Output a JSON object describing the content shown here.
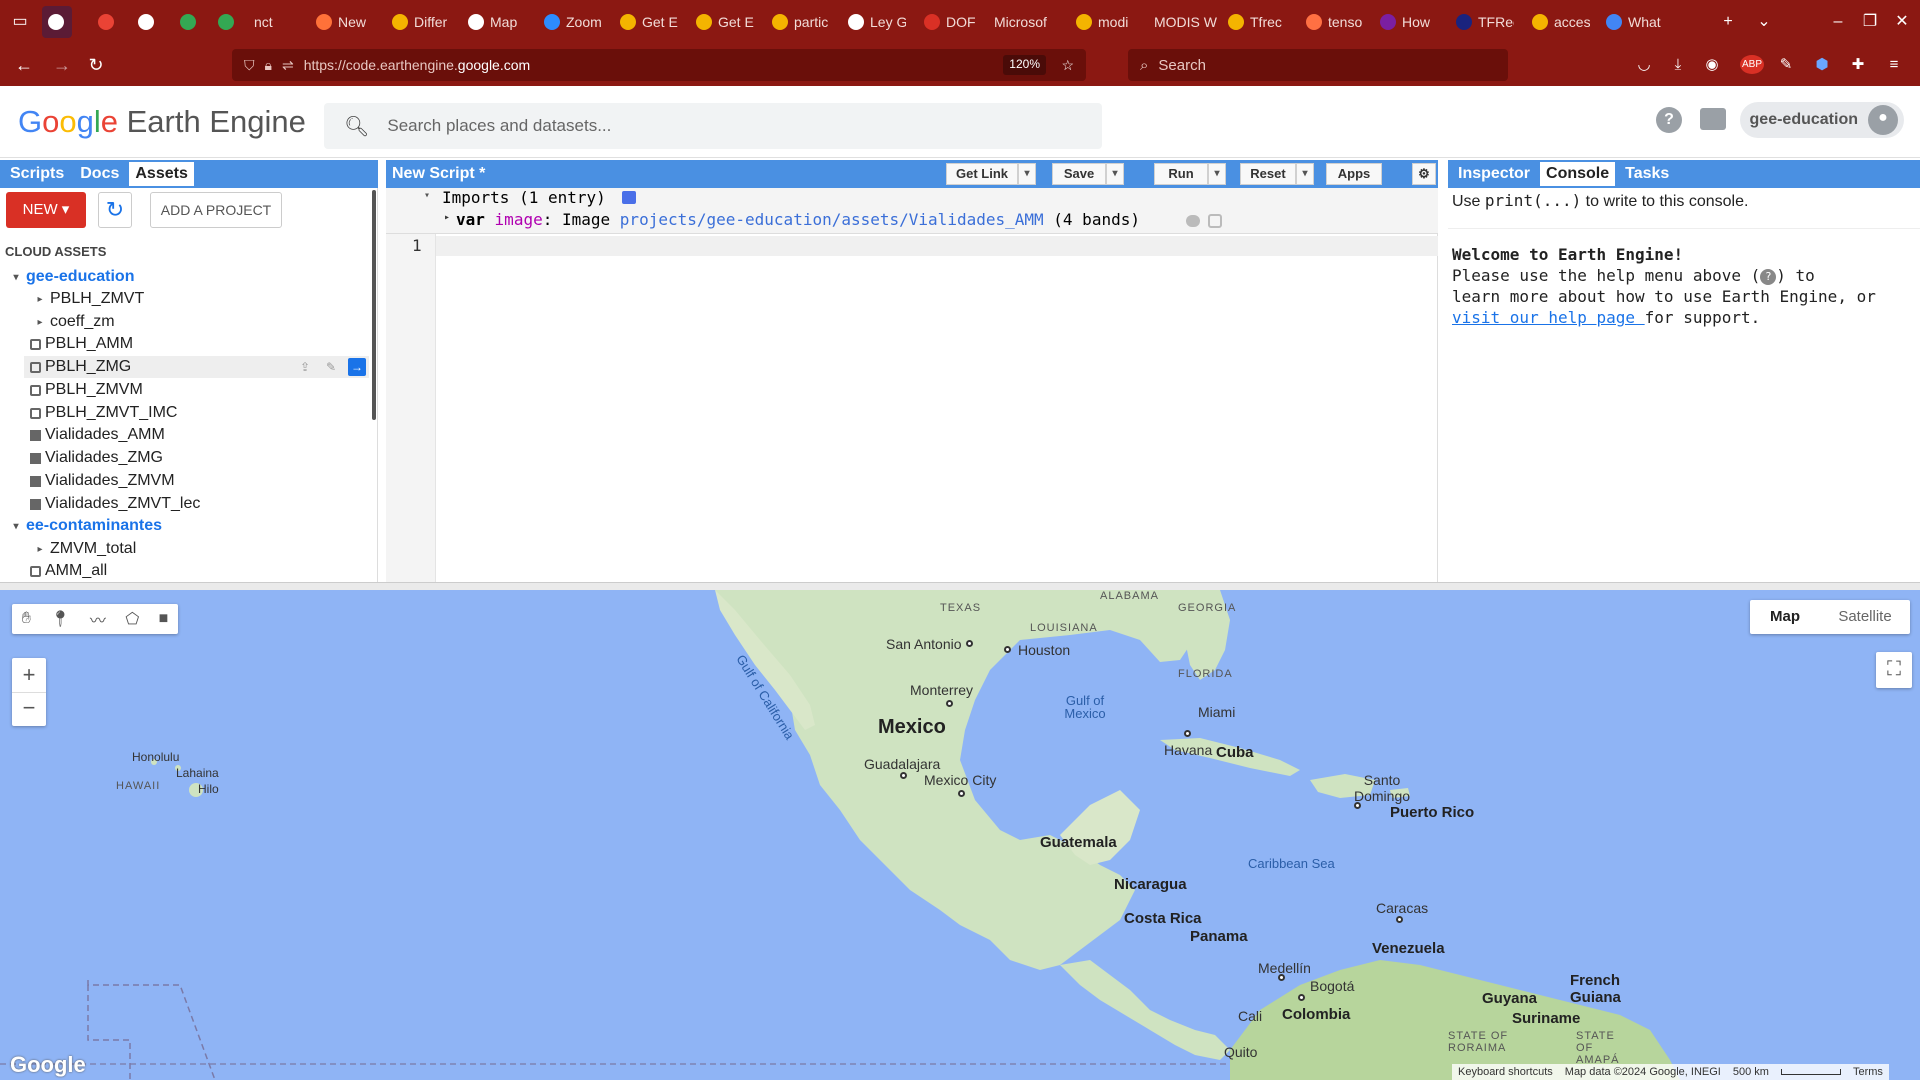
{
  "browser": {
    "tabs": [
      {
        "label": "",
        "color": "#ffffff"
      },
      {
        "label": "",
        "color": "#ea4335"
      },
      {
        "label": "",
        "color": "#ffffff"
      },
      {
        "label": "",
        "color": "#34a853"
      },
      {
        "label": "",
        "color": "#34a853"
      },
      {
        "label": "nct",
        "color": ""
      },
      {
        "label": "New",
        "color": "#ff7139"
      },
      {
        "label": "Differ",
        "color": "#f4b400"
      },
      {
        "label": "Map",
        "color": "#ffffff"
      },
      {
        "label": "Zoom",
        "color": "#2d8cff"
      },
      {
        "label": "Get E",
        "color": "#f4b400"
      },
      {
        "label": "Get E",
        "color": "#f4b400"
      },
      {
        "label": "partic",
        "color": "#f4b400"
      },
      {
        "label": "Ley G",
        "color": "#ffffff"
      },
      {
        "label": "DOF",
        "color": "#d93025"
      },
      {
        "label": "Microsof",
        "color": ""
      },
      {
        "label": "modi",
        "color": "#f4b400"
      },
      {
        "label": "MODIS W",
        "color": ""
      },
      {
        "label": "Tfrec",
        "color": "#f4b400"
      },
      {
        "label": "tenso",
        "color": "#ff7043"
      },
      {
        "label": "How",
        "color": "#7b1fa2"
      },
      {
        "label": "TFRec",
        "color": "#1a237e"
      },
      {
        "label": "acces",
        "color": "#f4b400"
      },
      {
        "label": "What",
        "color": "#4285f4"
      }
    ],
    "url_prefix": "https://code.earthengine.",
    "url_host": "google.com",
    "zoom": "120%",
    "search_placeholder": "Search"
  },
  "header": {
    "logo_google": [
      "G",
      "o",
      "o",
      "g",
      "l",
      "e"
    ],
    "logo_rest": " Earth Engine",
    "search_placeholder": "Search places and datasets...",
    "username": "gee-education"
  },
  "left_panel": {
    "tabs": [
      "Scripts",
      "Docs",
      "Assets"
    ],
    "new_label": "NEW",
    "add_project_label": "ADD A PROJECT",
    "cloud_assets_label": "CLOUD ASSETS",
    "tree": [
      {
        "label": "gee-education",
        "type": "root"
      },
      {
        "label": "PBLH_ZMVT",
        "type": "folder"
      },
      {
        "label": "coeff_zm",
        "type": "folder"
      },
      {
        "label": "PBLH_AMM",
        "type": "collection"
      },
      {
        "label": "PBLH_ZMG",
        "type": "collection"
      },
      {
        "label": "PBLH_ZMVM",
        "type": "collection"
      },
      {
        "label": "PBLH_ZMVT_IMC",
        "type": "collection"
      },
      {
        "label": "Vialidades_AMM",
        "type": "image"
      },
      {
        "label": "Vialidades_ZMG",
        "type": "image"
      },
      {
        "label": "Vialidades_ZMVM",
        "type": "image"
      },
      {
        "label": "Vialidades_ZMVT_lec",
        "type": "image"
      },
      {
        "label": "ee-contaminantes",
        "type": "root"
      },
      {
        "label": "ZMVM_total",
        "type": "folder"
      },
      {
        "label": "AMM_all",
        "type": "collection"
      }
    ]
  },
  "editor": {
    "title": "New Script *",
    "buttons": {
      "get_link": "Get Link",
      "save": "Save",
      "run": "Run",
      "reset": "Reset",
      "apps": "Apps"
    },
    "imports_label": "Imports (1 entry)",
    "import_var": "var",
    "import_name": "image",
    "import_type": "Image",
    "import_path": "projects/gee-education/assets/Vialidades_AMM",
    "import_bands": "(4 bands)",
    "line_number": "1"
  },
  "console": {
    "tabs": [
      "Inspector",
      "Console",
      "Tasks"
    ],
    "hint_pre": "Use ",
    "hint_code": "print(...)",
    "hint_post": " to write to this console.",
    "welcome_title": "Welcome to Earth Engine!",
    "welcome_line1": "Please use the help menu above (",
    "welcome_line1b": ") to",
    "welcome_line2": "learn more about how to use Earth Engine, or",
    "help_link": "visit our help page ",
    "welcome_line3": "for support."
  },
  "map": {
    "type_buttons": [
      "Map",
      "Satellite"
    ],
    "labels": {
      "texas": "TEXAS",
      "alabama": "ALABAMA",
      "georgia": "GEORGIA",
      "louisiana": "LOUISIANA",
      "florida": "FLORIDA",
      "san_antonio": "San Antonio",
      "houston": "Houston",
      "monterrey": "Monterrey",
      "mexico": "Mexico",
      "guadalajara": "Guadalajara",
      "mexico_city": "Mexico City",
      "gulf_mexico": "Gulf of Mexico",
      "gulf_california": "Gulf of California",
      "miami": "Miami",
      "havana": "Havana",
      "cuba": "Cuba",
      "santo_domingo": "Santo Domingo",
      "puerto_rico": "Puerto Rico",
      "guatemala": "Guatemala",
      "nicaragua": "Nicaragua",
      "costa_rica": "Costa Rica",
      "panama": "Panama",
      "caribbean_sea": "Caribbean Sea",
      "caracas": "Caracas",
      "venezuela": "Venezuela",
      "medellin": "Medellín",
      "bogota": "Bogotá",
      "cali": "Cali",
      "colombia": "Colombia",
      "quito": "Quito",
      "guyana": "Guyana",
      "suriname": "Suriname",
      "french_guiana": "French Guiana",
      "roraima": "STATE OF RORAIMA",
      "amapa": "STATE OF AMAPÁ",
      "honolulu": "Honolulu",
      "lahaina": "Lahaina",
      "hawaii": "HAWAII",
      "hilo": "Hilo"
    },
    "attribution": {
      "shortcuts": "Keyboard shortcuts",
      "data": "Map data ©2024 Google, INEGI",
      "scale": "500 km",
      "terms": "Terms"
    },
    "google_logo": "Google"
  }
}
